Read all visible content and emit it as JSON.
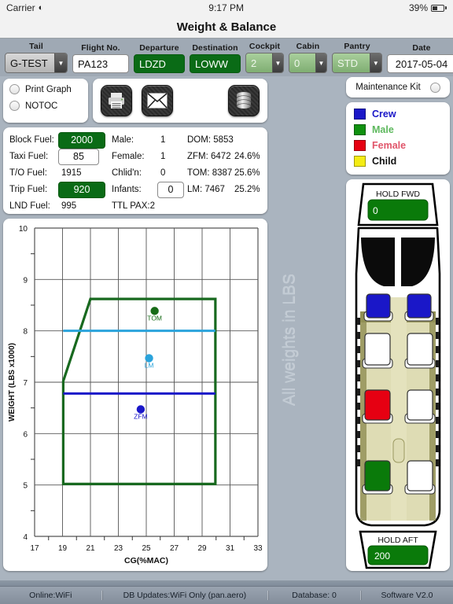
{
  "status_bar": {
    "carrier": "Carrier",
    "wifi_icon": "wifi-icon",
    "time": "9:17 PM",
    "battery_pct": "39%"
  },
  "nav": {
    "title": "Weight & Balance"
  },
  "form": {
    "tail": {
      "label": "Tail",
      "value": "G-TEST"
    },
    "flight_no": {
      "label": "Flight No.",
      "value": "PA123"
    },
    "departure": {
      "label": "Departure",
      "value": "LDZD"
    },
    "destination": {
      "label": "Destination",
      "value": "LOWW"
    },
    "cockpit": {
      "label": "Cockpit",
      "value": "2"
    },
    "cabin": {
      "label": "Cabin",
      "value": "0"
    },
    "pantry": {
      "label": "Pantry",
      "value": "STD"
    },
    "date": {
      "label": "Date",
      "value": "2017-05-04"
    }
  },
  "checkboxes": [
    {
      "label": "Print Graph",
      "checked": false
    },
    {
      "label": "NOTOC",
      "checked": false
    }
  ],
  "action_icons": [
    {
      "name": "printer-icon",
      "label": "Print"
    },
    {
      "name": "envelope-icon",
      "label": "Email"
    },
    {
      "name": "database-icon",
      "label": "Database"
    }
  ],
  "fuel": {
    "block_fuel": {
      "label": "Block Fuel:",
      "value": "2000"
    },
    "taxi_fuel": {
      "label": "Taxi Fuel:",
      "value": "85"
    },
    "to_fuel": {
      "label": "T/O Fuel:",
      "value": "1915"
    },
    "trip_fuel": {
      "label": "Trip Fuel:",
      "value": "920"
    },
    "lnd_fuel": {
      "label": "LND Fuel:",
      "value": "995"
    }
  },
  "pax": {
    "male": {
      "label": "Male:",
      "value": "1"
    },
    "female": {
      "label": "Female:",
      "value": "1"
    },
    "children": {
      "label": "Chlid'n:",
      "value": "0"
    },
    "infants": {
      "label": "Infants:",
      "value": "0"
    },
    "total": {
      "label": "TTL PAX:2"
    }
  },
  "weights": {
    "dom": {
      "label": "DOM: 5853",
      "pct": ""
    },
    "zfm": {
      "label": "ZFM:  6472",
      "pct": "24.6%"
    },
    "tom": {
      "label": "TOM: 8387",
      "pct": "25.6%"
    },
    "lm": {
      "label": "LM:   7467",
      "pct": "25.2%"
    }
  },
  "watermark": "All weights in LBS",
  "maintenance_kit": {
    "label": "Maintenance Kit",
    "checked": false
  },
  "legend": [
    {
      "label": "Crew",
      "color": "#1a17c8"
    },
    {
      "label": "Male",
      "color": "#109110"
    },
    {
      "label": "Female",
      "color": "#e60012"
    },
    {
      "label": "Child",
      "color": "#f4ec14"
    }
  ],
  "holds": {
    "fwd": {
      "label": "HOLD FWD",
      "value": "0"
    },
    "aft": {
      "label": "HOLD AFT",
      "value": "200"
    }
  },
  "seats": [
    {
      "position": "cockpit-left",
      "occupant": "Crew",
      "color": "#1a17c8"
    },
    {
      "position": "cockpit-right",
      "occupant": "Crew",
      "color": "#1a17c8"
    },
    {
      "position": "cabin-row1-left",
      "occupant": "",
      "color": "#ffffff"
    },
    {
      "position": "cabin-row1-right",
      "occupant": "",
      "color": "#ffffff"
    },
    {
      "position": "cabin-row2-left",
      "occupant": "Female",
      "color": "#e60012"
    },
    {
      "position": "cabin-row2-right",
      "occupant": "",
      "color": "#ffffff"
    },
    {
      "position": "cabin-row3-left",
      "occupant": "Male",
      "color": "#0a7a0a"
    },
    {
      "position": "cabin-row3-right",
      "occupant": "",
      "color": "#ffffff"
    }
  ],
  "footer": [
    {
      "text": "Online:WiFi"
    },
    {
      "text": "DB Updates:WiFi Only   (pan.aero)"
    },
    {
      "text": "Database: 0"
    },
    {
      "text": "Software V2.0"
    }
  ],
  "chart_data": {
    "type": "scatter",
    "title": "",
    "xlabel": "CG(%MAC)",
    "ylabel": "WEIGHT (LBS x1000)",
    "xlim": [
      17,
      33
    ],
    "ylim": [
      4,
      10
    ],
    "xticks": [
      17,
      19,
      21,
      23,
      25,
      27,
      29,
      31,
      33
    ],
    "yticks": [
      4,
      5,
      6,
      7,
      8,
      9,
      10
    ],
    "minor_yticks": [
      4.5,
      5.5,
      6.5,
      7.5,
      8.5,
      9.5
    ],
    "grid": true,
    "envelope": {
      "name": "CG envelope",
      "color": "#18691f",
      "points": [
        [
          19.05,
          5.02
        ],
        [
          19.05,
          7.02
        ],
        [
          21.0,
          8.62
        ],
        [
          29.95,
          8.62
        ],
        [
          29.95,
          5.02
        ],
        [
          19.05,
          5.02
        ]
      ]
    },
    "limit_lines": [
      {
        "name": "LM limit",
        "color": "#2aa3db",
        "y": 8.0,
        "x_from": 19.05,
        "x_to": 29.95
      },
      {
        "name": "ZFM limit",
        "color": "#1a17c8",
        "y": 6.78,
        "x_from": 19.05,
        "x_to": 29.95
      }
    ],
    "points": [
      {
        "label": "TOM",
        "x": 25.6,
        "y": 8.387,
        "color": "#176b17"
      },
      {
        "label": "LM",
        "x": 25.2,
        "y": 7.467,
        "color": "#2aa3db"
      },
      {
        "label": "ZFM",
        "x": 24.6,
        "y": 6.472,
        "color": "#1a17c8"
      }
    ]
  }
}
